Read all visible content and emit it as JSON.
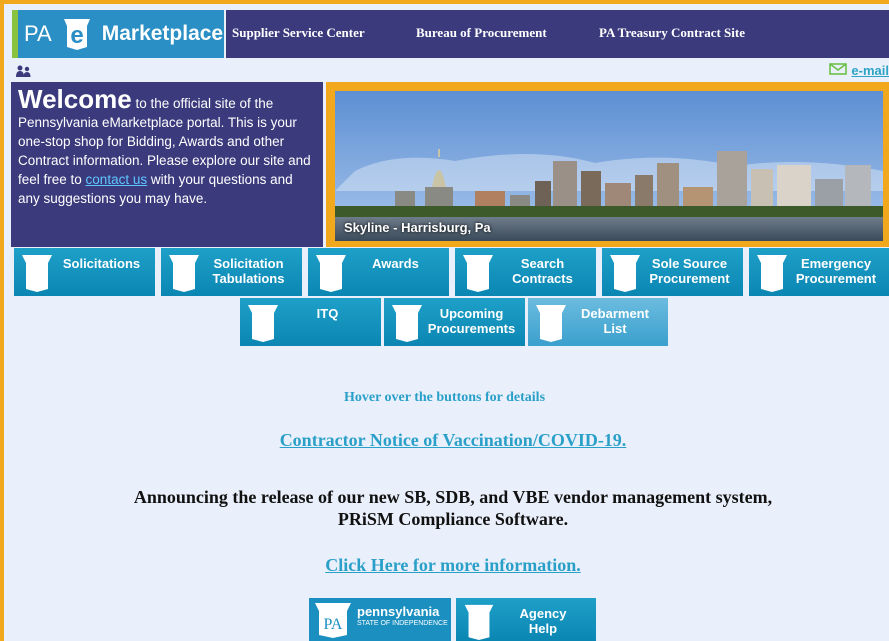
{
  "header": {
    "logo_prefix": "PA",
    "logo_e": "e",
    "logo_name": "Marketplace",
    "nav": [
      "Supplier Service Center",
      "Bureau of Procurement",
      "PA Treasury Contract Site"
    ]
  },
  "utility": {
    "email_label": "e-mail"
  },
  "welcome": {
    "heading": "Welcome",
    "text_1": " to the official site of the Pennsylvania eMarketplace portal. This is your one-stop shop for Bidding, Awards and other Contract information. Please explore our site and feel free to ",
    "link": "contact us",
    "text_2": " with your questions and any suggestions you may have."
  },
  "banner": {
    "caption": "Skyline - Harrisburg, Pa"
  },
  "buttons_row1": [
    {
      "line1": "Solicitations",
      "line2": ""
    },
    {
      "line1": "Solicitation",
      "line2": "Tabulations"
    },
    {
      "line1": "Awards",
      "line2": ""
    },
    {
      "line1": "Search",
      "line2": "Contracts"
    },
    {
      "line1": "Sole Source",
      "line2": "Procurement"
    },
    {
      "line1": "Emergency",
      "line2": "Procurement"
    }
  ],
  "buttons_row2": [
    {
      "line1": "ITQ",
      "line2": ""
    },
    {
      "line1": "Upcoming",
      "line2": "Procurements"
    },
    {
      "line1": "Debarment",
      "line2": "List"
    }
  ],
  "main": {
    "hover_note": "Hover over the buttons for details",
    "covid_link": "Contractor Notice of Vaccination/COVID-19.",
    "announce_1": "Announcing the release of our new SB, SDB, and VBE vendor management system,",
    "announce_2": "PRiSM Compliance Software.",
    "more_link": "Click Here for more information."
  },
  "footer": {
    "state_name": "pennsylvania",
    "state_tagline": "STATE OF INDEPENDENCE",
    "state_abbr": "PA",
    "agency_help_1": "Agency",
    "agency_help_2": "Help"
  },
  "colors": {
    "navy": "#3a3a7d",
    "teal": "#1a9ac6",
    "gold": "#f2a81d",
    "link": "#2aa0c9"
  }
}
